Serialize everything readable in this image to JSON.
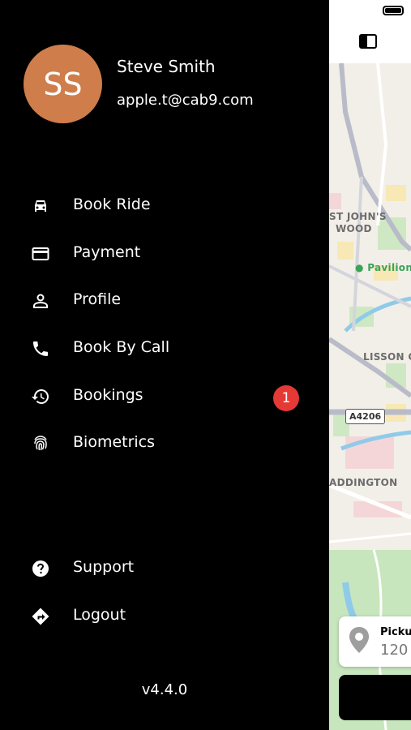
{
  "user": {
    "initials": "SS",
    "name": "Steve Smith",
    "email": "apple.t@cab9.com"
  },
  "menu": [
    {
      "label": "Book Ride",
      "icon": "car-icon"
    },
    {
      "label": "Payment",
      "icon": "credit-card-icon"
    },
    {
      "label": "Profile",
      "icon": "person-icon"
    },
    {
      "label": "Book By Call",
      "icon": "phone-icon"
    },
    {
      "label": "Bookings",
      "icon": "history-icon",
      "badge": "1"
    },
    {
      "label": "Biometrics",
      "icon": "fingerprint-icon"
    }
  ],
  "footer_menu": [
    {
      "label": "Support",
      "icon": "help-icon"
    },
    {
      "label": "Logout",
      "icon": "directions-icon"
    }
  ],
  "version": "v4.4.0",
  "map": {
    "labels": [
      "ST JOHN'S",
      "WOOD",
      "Pavilion",
      "LISSON GR",
      "A4206",
      "ADDINGTON"
    ],
    "pickup_title": "Pickup",
    "pickup_value": "120"
  },
  "colors": {
    "avatar": "#cf7e4b",
    "badge": "#e53935",
    "drawer_bg": "#000000"
  }
}
